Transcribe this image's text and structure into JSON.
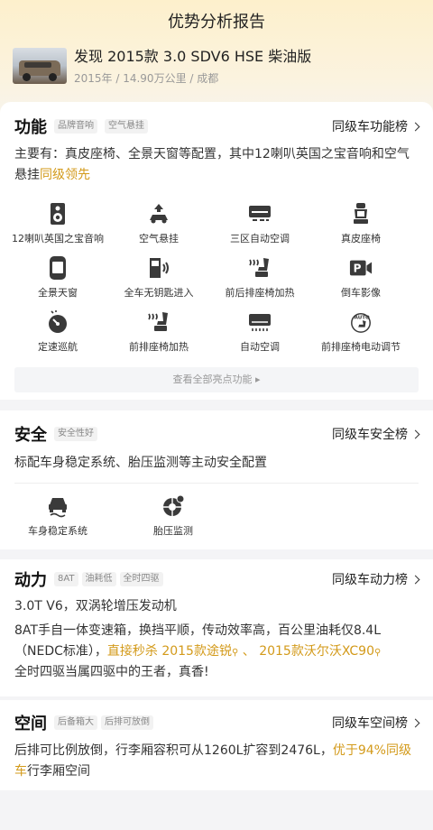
{
  "header": {
    "title": "优势分析报告"
  },
  "car": {
    "name": "发现 2015款 3.0 SDV6 HSE 柴油版",
    "meta": "2015年 / 14.90万公里 / 成都"
  },
  "function": {
    "title": "功能",
    "tags": [
      "品牌音响",
      "空气悬挂"
    ],
    "rank_link": "同级车功能榜",
    "desc": "主要有：真皮座椅、全景天窗等配置，其中12喇叭英国之宝音响和空气悬挂",
    "desc_highlight": "同级领先",
    "features": [
      {
        "label": "12喇叭英国之宝音响",
        "icon": "speaker-icon"
      },
      {
        "label": "空气悬挂",
        "icon": "air-suspension-icon"
      },
      {
        "label": "三区自动空调",
        "icon": "climate-control-icon"
      },
      {
        "label": "真皮座椅",
        "icon": "leather-seat-icon"
      },
      {
        "label": "全景天窗",
        "icon": "sunroof-icon"
      },
      {
        "label": "全车无钥匙进入",
        "icon": "keyless-entry-icon"
      },
      {
        "label": "前后排座椅加热",
        "icon": "seat-heating-icon"
      },
      {
        "label": "倒车影像",
        "icon": "reverse-camera-icon"
      },
      {
        "label": "定速巡航",
        "icon": "cruise-control-icon"
      },
      {
        "label": "前排座椅加热",
        "icon": "front-seat-heating-icon"
      },
      {
        "label": "自动空调",
        "icon": "auto-ac-icon"
      },
      {
        "label": "前排座椅电动调节",
        "icon": "power-seat-icon"
      }
    ],
    "more_label": "查看全部亮点功能 ▸"
  },
  "safety": {
    "title": "安全",
    "tags": [
      "安全性好"
    ],
    "rank_link": "同级车安全榜",
    "desc": "标配车身稳定系统、胎压监测等主动安全配置",
    "features": [
      {
        "label": "车身稳定系统",
        "icon": "stability-control-icon"
      },
      {
        "label": "胎压监测",
        "icon": "tire-pressure-icon"
      }
    ]
  },
  "power": {
    "title": "动力",
    "tags": [
      "8AT",
      "油耗低",
      "全时四驱"
    ],
    "rank_link": "同级车动力榜",
    "line1": "3.0T V6，双涡轮增压发动机",
    "line2": "8AT手自一体变速箱，换挡平顺，传动效率高，百公里油耗仅8.4L（NEDC标准），",
    "line2_gold_prefix": "直接秒杀 ",
    "competitors": [
      "2015款途锐",
      "2015款沃尔沃XC90"
    ],
    "sep": " 、 ",
    "line3": "全时四驱当属四驱中的王者，真香!"
  },
  "space": {
    "title": "空间",
    "tags": [
      "后备箱大",
      "后排可放倒"
    ],
    "rank_link": "同级车空间榜",
    "desc": "后排可比例放倒，行李厢容积可从1260L扩容到2476L，",
    "desc_highlight": "优于94%同级车",
    "desc_tail": "行李厢空间"
  }
}
